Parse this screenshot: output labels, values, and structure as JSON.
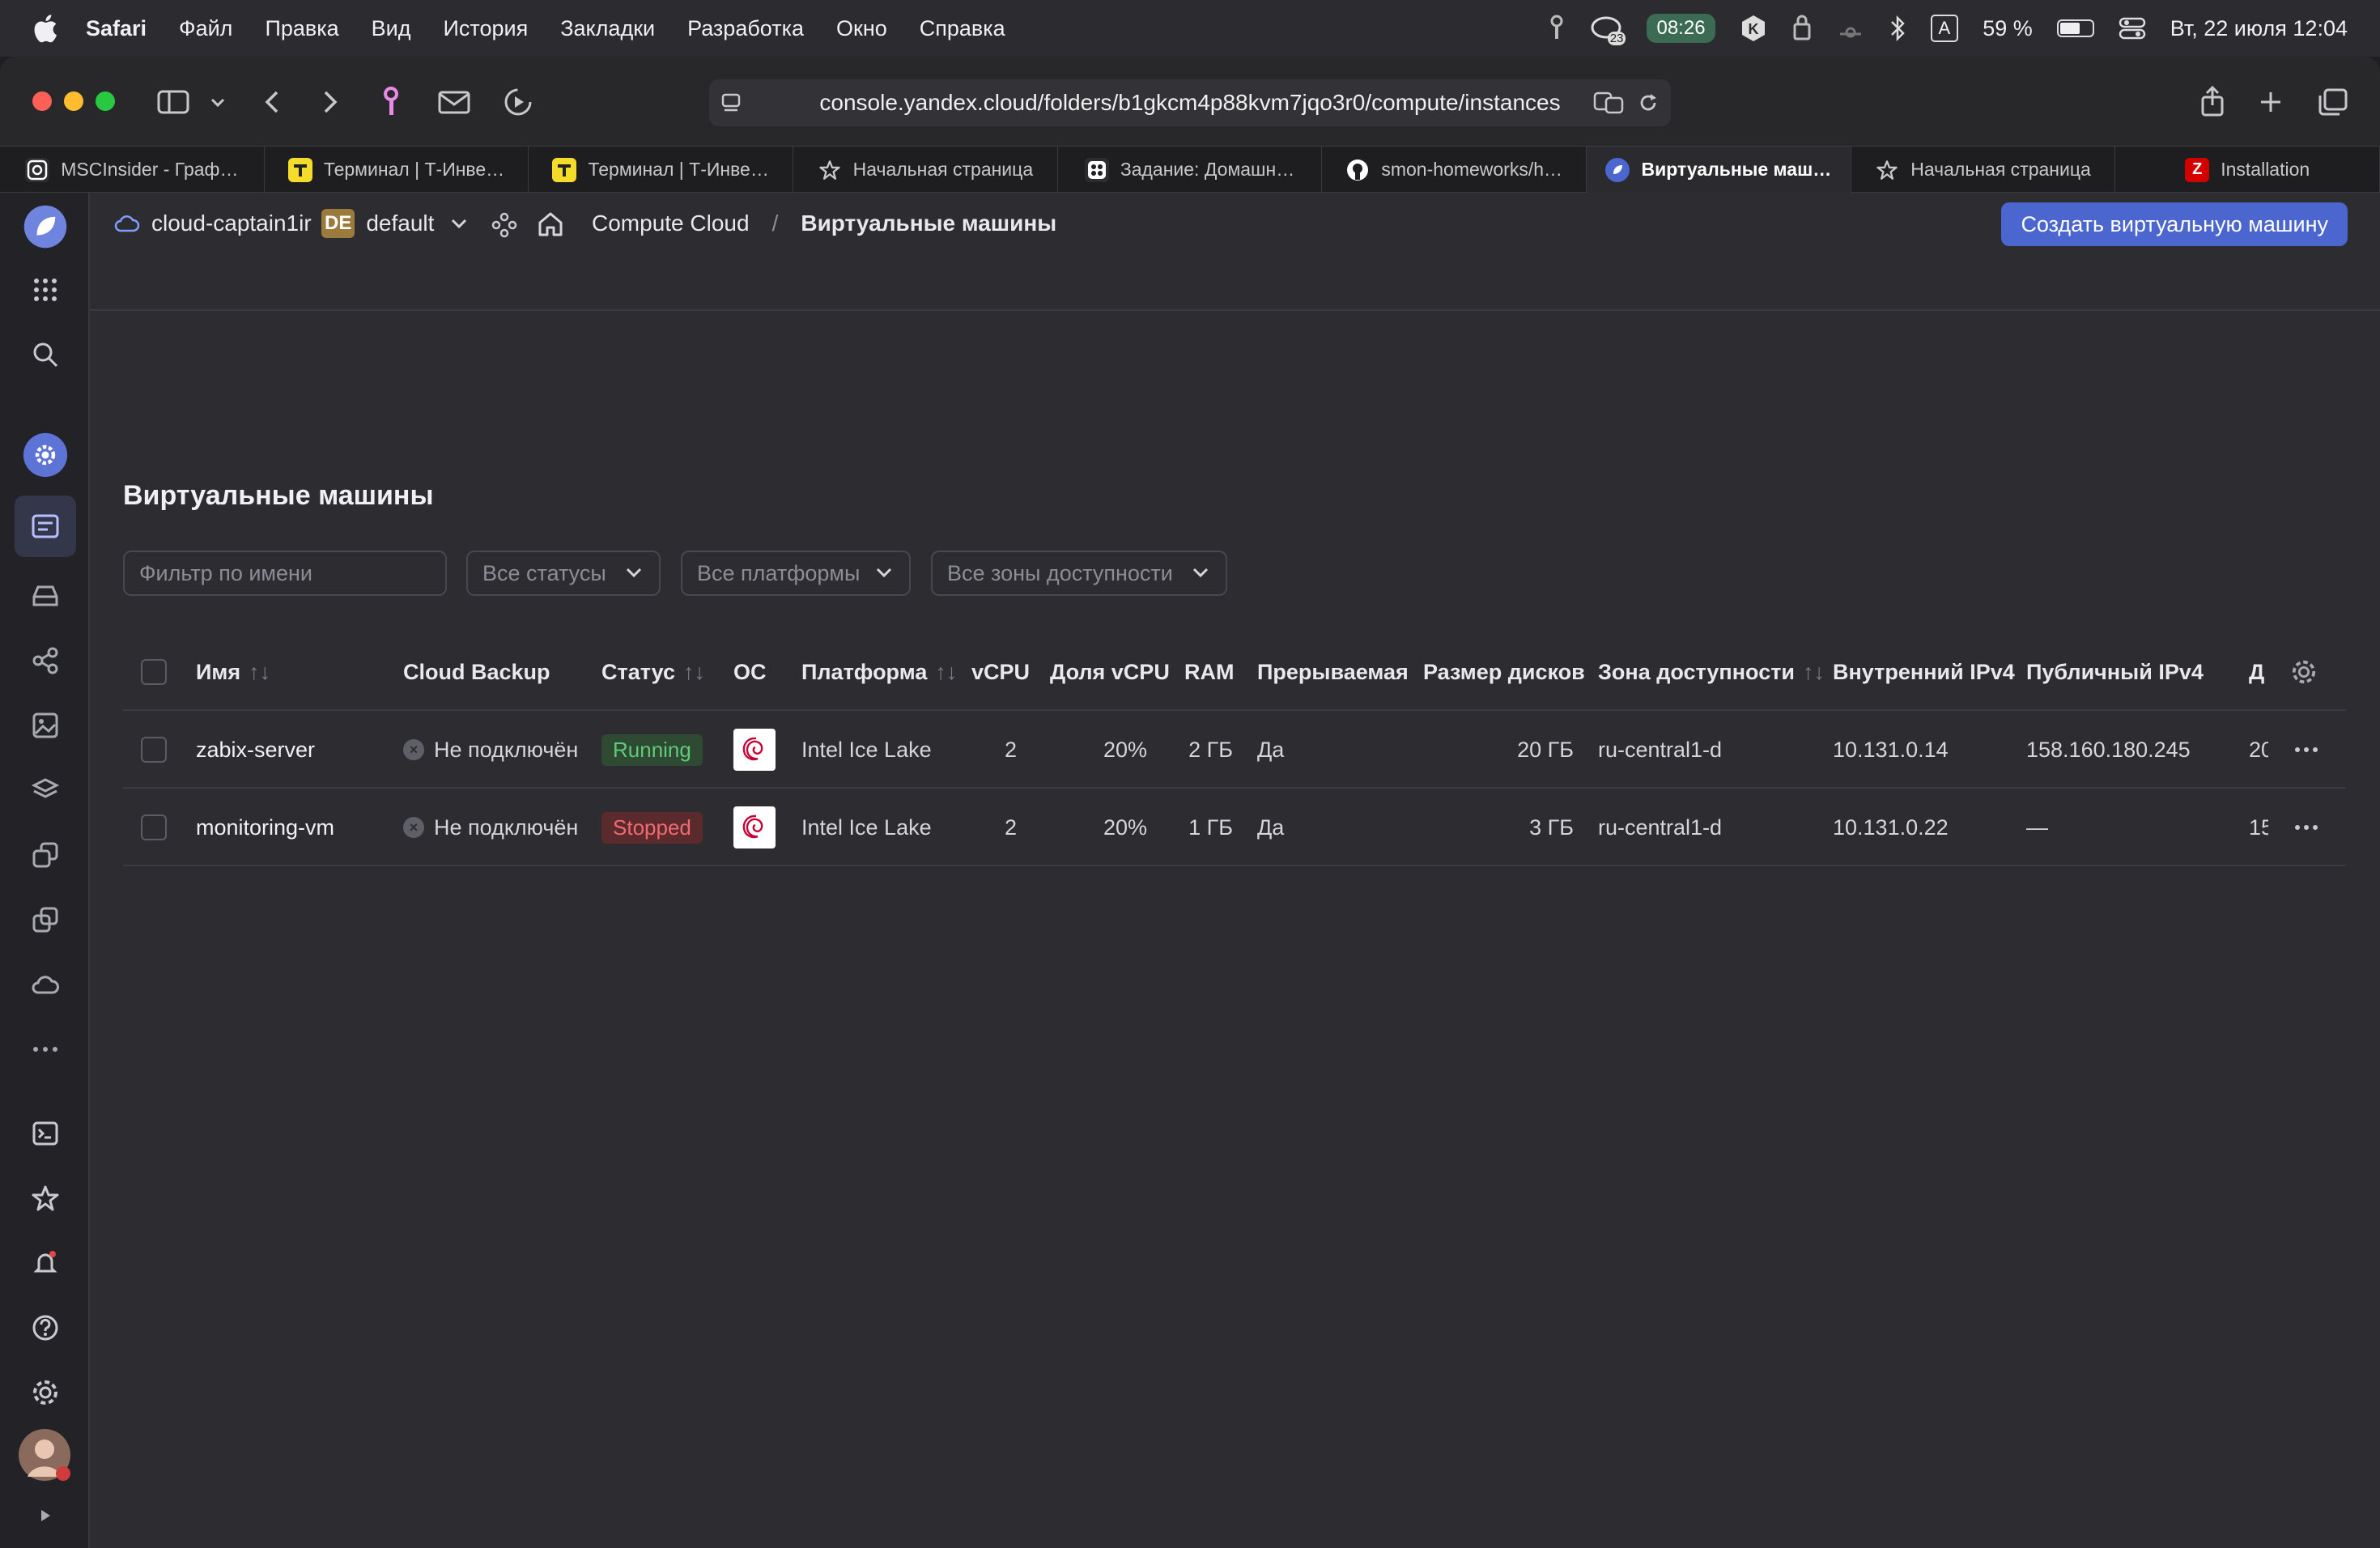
{
  "menubar": {
    "items": [
      "Safari",
      "Файл",
      "Правка",
      "Вид",
      "История",
      "Закладки",
      "Разработка",
      "Окно",
      "Справка"
    ],
    "badge_count": "23",
    "timer": "08:26",
    "input_lang": "A",
    "battery": "59 %",
    "datetime": "Вт, 22 июля  12:04"
  },
  "browser": {
    "url": "console.yandex.cloud/folders/b1gkcm4p88kvm7jqo3r0/compute/instances",
    "tabs": [
      {
        "label": "MSCInsider - Граф…",
        "icon": "mscinsider-favicon",
        "color": "#ffffff",
        "bg": "#2d2d30"
      },
      {
        "label": "Терминал | Т-Инве…",
        "icon": "tinvest-favicon",
        "color": "#222",
        "bg": "#f5dc2b"
      },
      {
        "label": "Терминал | Т-Инве…",
        "icon": "tinvest-favicon",
        "color": "#222",
        "bg": "#f5dc2b"
      },
      {
        "label": "Начальная страница",
        "icon": "star-icon",
        "color": "#c8c8cc",
        "bg": "transparent"
      },
      {
        "label": "Задание: Домашн…",
        "icon": "netology-favicon",
        "color": "#fff",
        "bg": "#2d2d30"
      },
      {
        "label": "smon-homeworks/h…",
        "icon": "github-favicon",
        "color": "#fff",
        "bg": "transparent"
      },
      {
        "label": "Виртуальные маш…",
        "icon": "yandex-cloud-favicon",
        "color": "#fff",
        "bg": "#4b66cf",
        "active": true
      },
      {
        "label": "Начальная страница",
        "icon": "star-icon",
        "color": "#c8c8cc",
        "bg": "transparent"
      },
      {
        "label": "Installation",
        "icon": "zabbix-favicon",
        "color": "#fff",
        "bg": "#d40000",
        "letter": "Z"
      }
    ]
  },
  "header": {
    "cloud": "cloud-captain1ir",
    "folder_badge": "DE",
    "folder": "default",
    "service": "Compute Cloud",
    "separator": "/",
    "current": "Виртуальные машины",
    "create_button": "Создать виртуальную машину"
  },
  "page": {
    "title": "Виртуальные машины",
    "filters": {
      "name_placeholder": "Фильтр по имени",
      "status": "Все статусы",
      "platform": "Все платформы",
      "zone": "Все зоны доступности"
    }
  },
  "table": {
    "columns": [
      "Имя",
      "Cloud Backup",
      "Статус",
      "ОС",
      "Платформа",
      "vCPU",
      "Доля vCPU",
      "RAM",
      "Прерываемая",
      "Размер дисков",
      "Зона доступности",
      "Внутренний IPv4",
      "Публичный IPv4",
      "Д"
    ],
    "rows": [
      {
        "name": "zabix-server",
        "backup": "Не подключён",
        "status": "Running",
        "os": "debian-icon",
        "platform": "Intel Ice Lake",
        "vcpu": "2",
        "share": "20%",
        "ram": "2 ГБ",
        "preemptible": "Да",
        "disk": "20 ГБ",
        "zone": "ru-central1-d",
        "ipv4": "10.131.0.14",
        "public": "158.160.180.245",
        "extra": "20"
      },
      {
        "name": "monitoring-vm",
        "backup": "Не подключён",
        "status": "Stopped",
        "os": "debian-icon",
        "platform": "Intel Ice Lake",
        "vcpu": "2",
        "share": "20%",
        "ram": "1 ГБ",
        "preemptible": "Да",
        "disk": "3 ГБ",
        "zone": "ru-central1-d",
        "ipv4": "10.131.0.22",
        "public": "—",
        "extra": "15"
      }
    ]
  },
  "colors": {
    "accent": "#4b66cf",
    "running": "#62c97a",
    "stopped": "#f06a71"
  }
}
